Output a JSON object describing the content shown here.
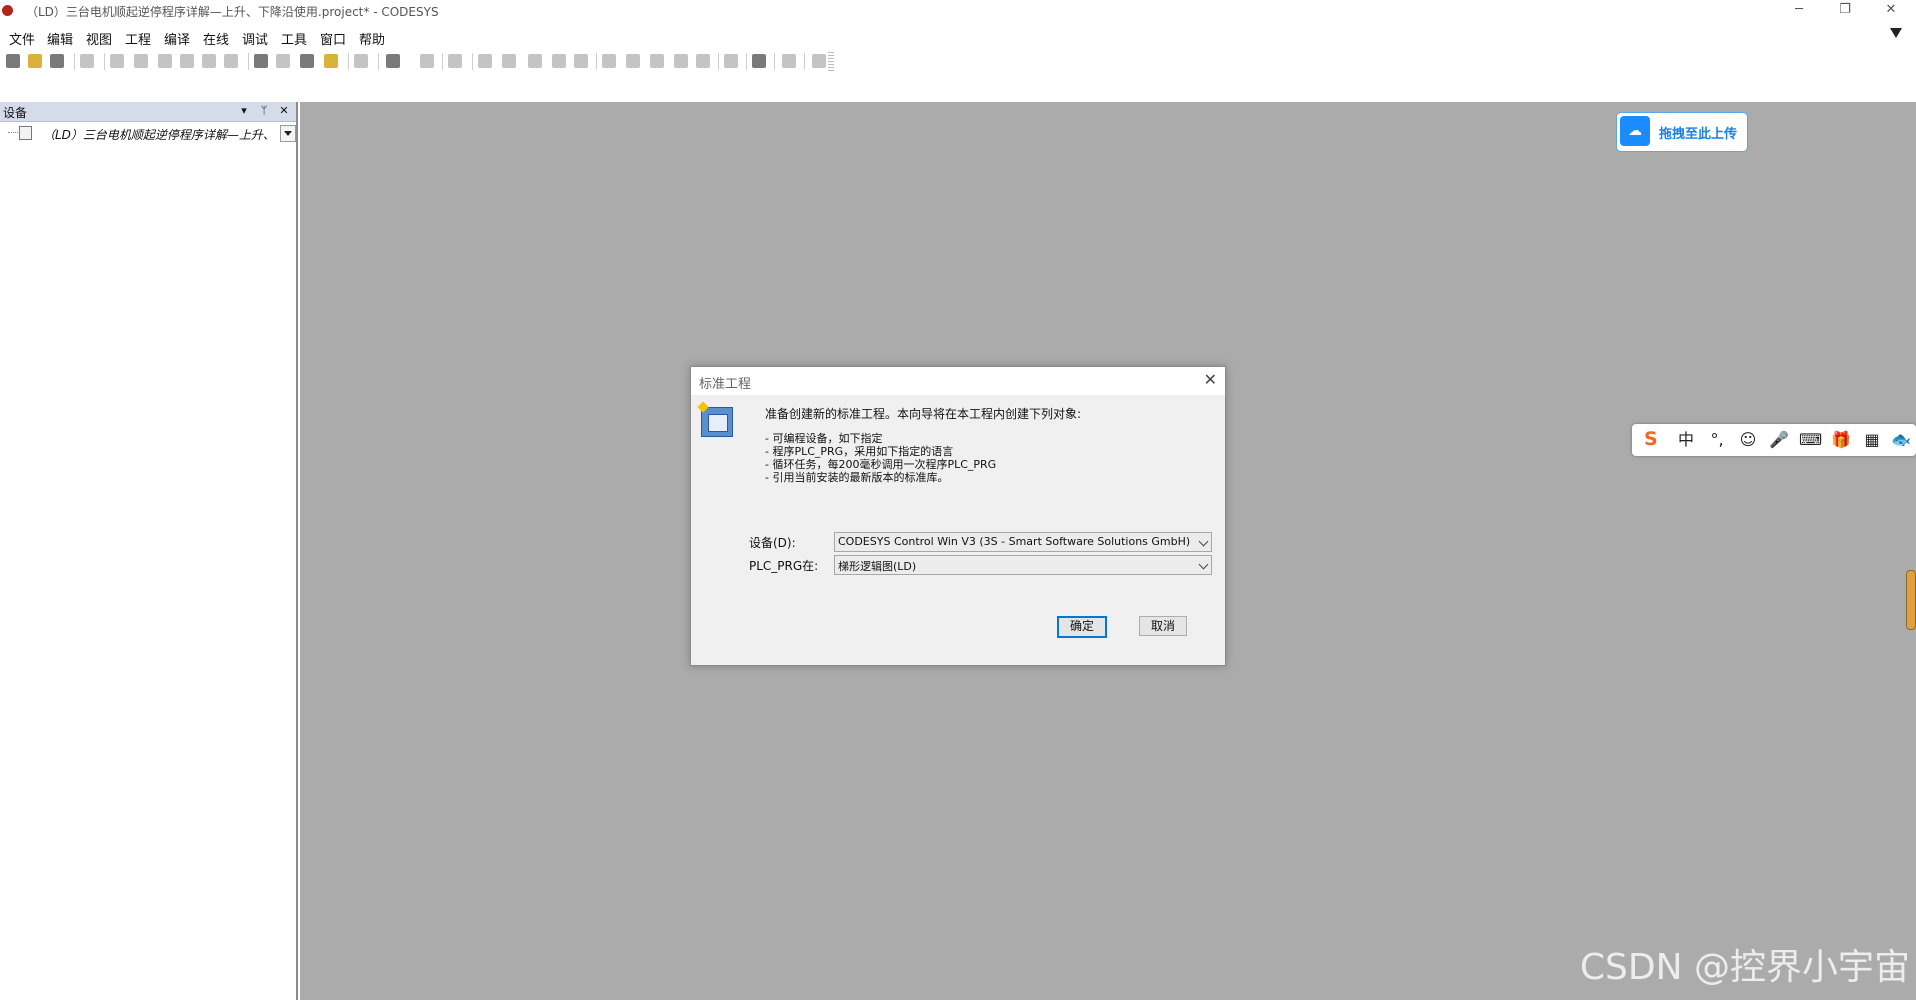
{
  "window": {
    "title": "（LD）三台电机顺起逆停程序详解—上升、下降沿使用.project* - CODESYS",
    "minimize": "─",
    "restore": "❐",
    "close": "✕"
  },
  "menu": [
    "文件",
    "编辑",
    "视图",
    "工程",
    "编译",
    "在线",
    "调试",
    "工具",
    "窗口",
    "帮助"
  ],
  "device_panel": {
    "title": "设备",
    "dropdown_glyph": "▾",
    "pin_glyph": "ᛘ",
    "close_glyph": "✕",
    "tree_item": "（LD）三台电机顺起逆停程序详解—上升、下降沿使用"
  },
  "cloud_upload": {
    "label": "拖拽至此上传",
    "icon": "cloud-upload-icon"
  },
  "ime_toolbar": {
    "logo": "S",
    "items": [
      "中",
      "°,",
      "☺",
      "🎤",
      "⌨",
      "🎁",
      "▦",
      "🐟"
    ]
  },
  "dialog": {
    "title": "标准工程",
    "close": "✕",
    "intro": "准备创建新的标准工程。本向导将在本工程内创建下列对象:",
    "items": [
      "- 可编程设备，如下指定",
      "- 程序PLC_PRG，采用如下指定的语言",
      "- 循环任务，每200毫秒调用一次程序PLC_PRG",
      "- 引用当前安装的最新版本的标准库。"
    ],
    "device_label": "设备(D):",
    "device_value": "CODESYS Control Win V3 (3S - Smart Software Solutions GmbH)",
    "plcprg_label": "PLC_PRG在:",
    "plcprg_value": "梯形逻辑图(LD)",
    "ok": "确定",
    "cancel": "取消"
  },
  "watermark": "CSDN @控界小宇宙",
  "colors": {
    "workspace": "#ababab",
    "panel_header": "#d6dbe9",
    "accent": "#0078d7",
    "cloud_blue": "#1a8cff",
    "ime_orange": "#f26522"
  }
}
